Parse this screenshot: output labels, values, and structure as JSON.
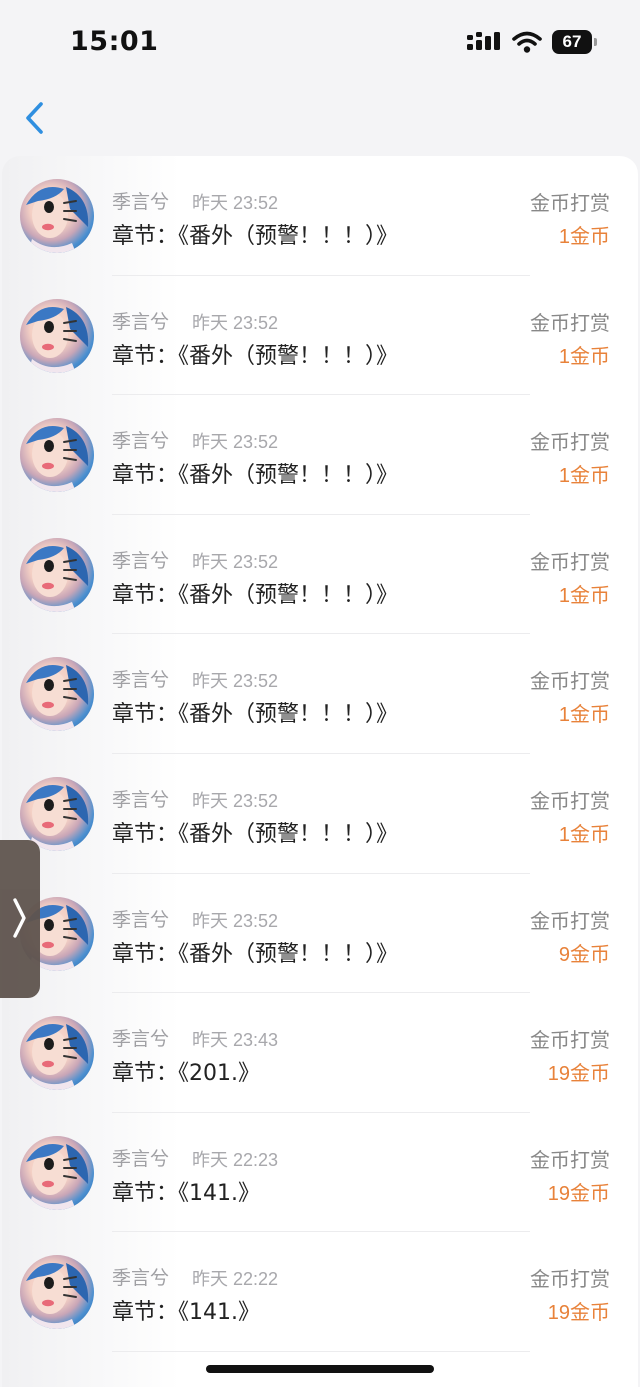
{
  "status_bar": {
    "time": "15:01",
    "battery": "67"
  },
  "nav": {
    "back_icon": "chevron-left-icon"
  },
  "rows": [
    {
      "username": "季言兮",
      "time": "昨天 23:52",
      "chapter": "章节：《番外（预警！！！）》",
      "type": "金币打赏",
      "amount_value": "1",
      "amount_unit": "金币"
    },
    {
      "username": "季言兮",
      "time": "昨天 23:52",
      "chapter": "章节：《番外（预警！！！）》",
      "type": "金币打赏",
      "amount_value": "1",
      "amount_unit": "金币"
    },
    {
      "username": "季言兮",
      "time": "昨天 23:52",
      "chapter": "章节：《番外（预警！！！）》",
      "type": "金币打赏",
      "amount_value": "1",
      "amount_unit": "金币"
    },
    {
      "username": "季言兮",
      "time": "昨天 23:52",
      "chapter": "章节：《番外（预警！！！）》",
      "type": "金币打赏",
      "amount_value": "1",
      "amount_unit": "金币"
    },
    {
      "username": "季言兮",
      "time": "昨天 23:52",
      "chapter": "章节：《番外（预警！！！）》",
      "type": "金币打赏",
      "amount_value": "1",
      "amount_unit": "金币"
    },
    {
      "username": "季言兮",
      "time": "昨天 23:52",
      "chapter": "章节：《番外（预警！！！）》",
      "type": "金币打赏",
      "amount_value": "1",
      "amount_unit": "金币"
    },
    {
      "username": "季言兮",
      "time": "昨天 23:52",
      "chapter": "章节：《番外（预警！！！）》",
      "type": "金币打赏",
      "amount_value": "9",
      "amount_unit": "金币"
    },
    {
      "username": "季言兮",
      "time": "昨天 23:43",
      "chapter": "章节：《201.》",
      "type": "金币打赏",
      "amount_value": "19",
      "amount_unit": "金币"
    },
    {
      "username": "季言兮",
      "time": "昨天 22:23",
      "chapter": "章节：《141.》",
      "type": "金币打赏",
      "amount_value": "19",
      "amount_unit": "金币"
    },
    {
      "username": "季言兮",
      "time": "昨天 22:22",
      "chapter": "章节：《141.》",
      "type": "金币打赏",
      "amount_value": "19",
      "amount_unit": "金币"
    }
  ],
  "colors": {
    "accent": "#e8823a",
    "back": "#2f8fe0"
  }
}
